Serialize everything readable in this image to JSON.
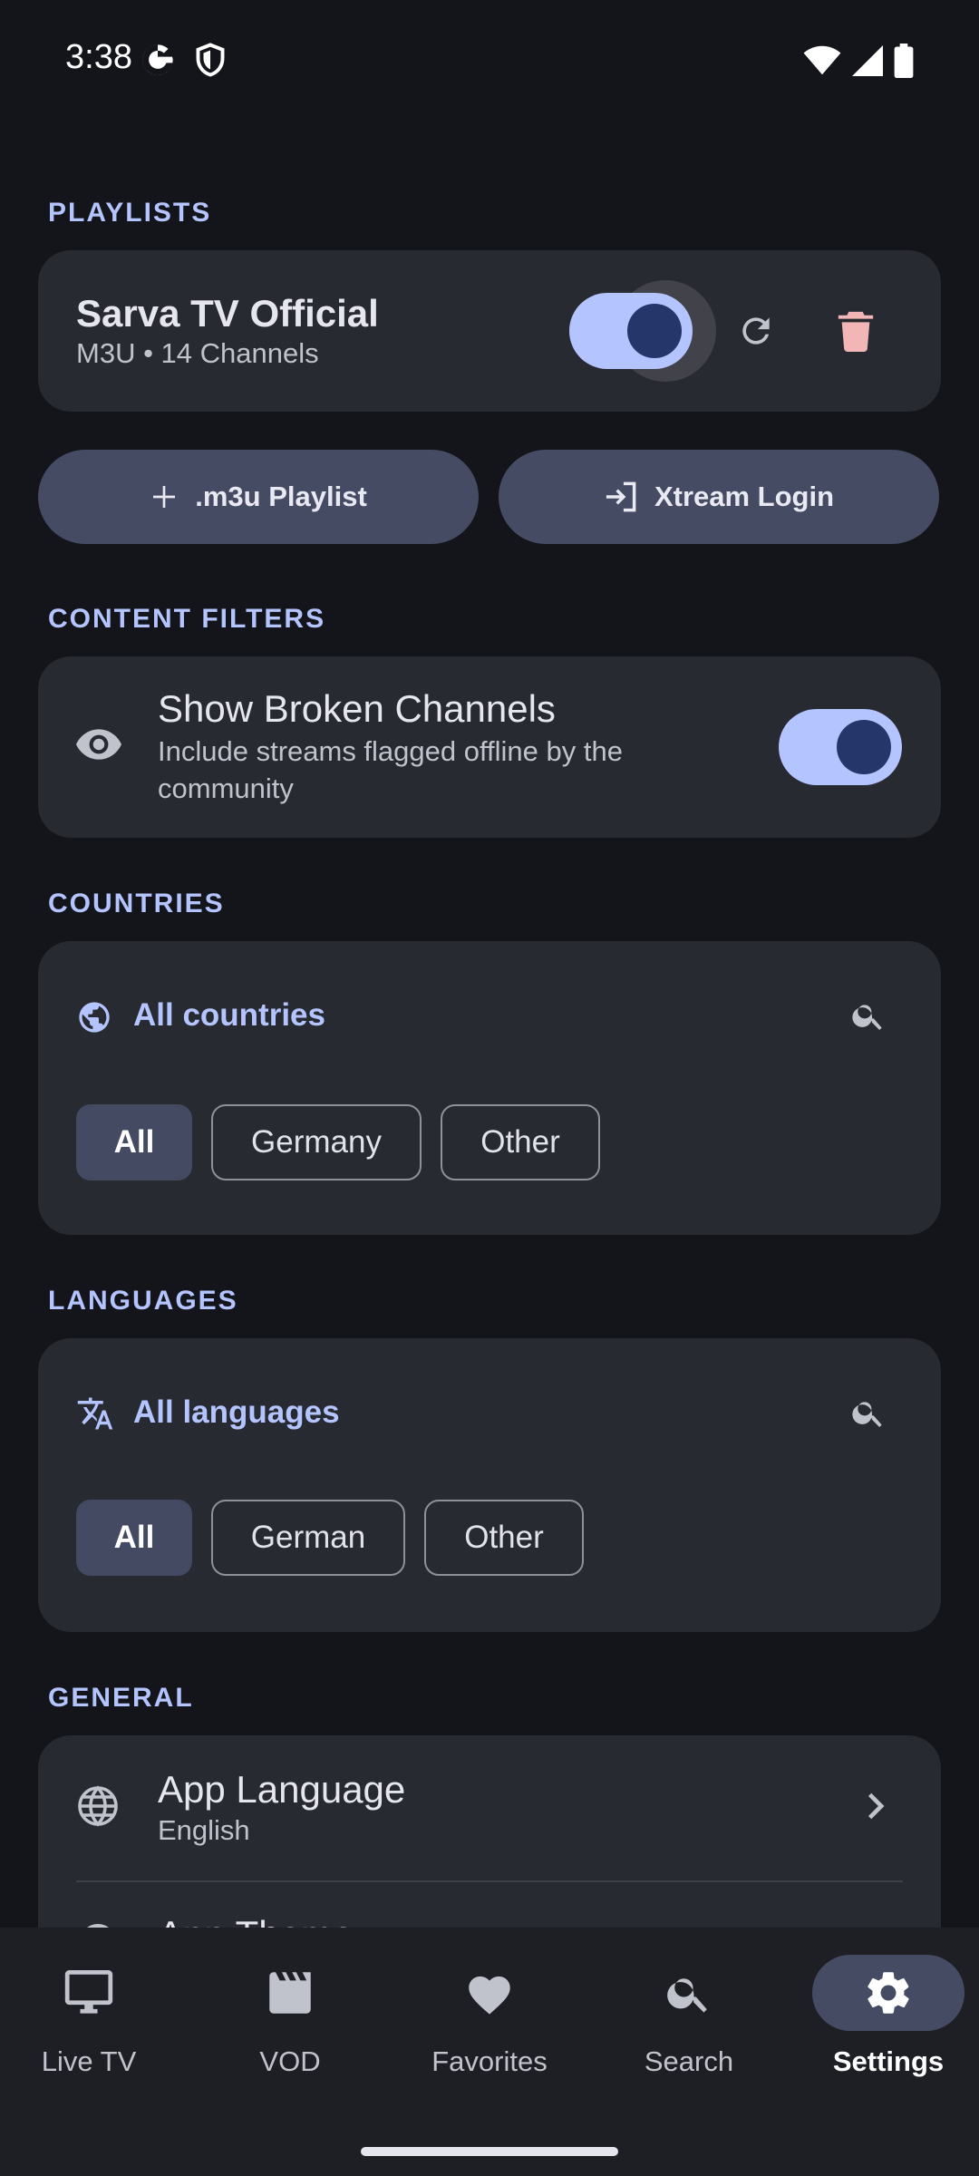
{
  "status_bar": {
    "time": "3:38"
  },
  "sections": {
    "playlists": "PLAYLISTS",
    "content_filters": "CONTENT FILTERS",
    "countries": "COUNTRIES",
    "languages": "LANGUAGES",
    "general": "GENERAL"
  },
  "playlist": {
    "name": "Sarva TV Official",
    "meta": "M3U • 14 Channels",
    "enabled": true
  },
  "buttons": {
    "add_m3u": ".m3u Playlist",
    "xtream_login": "Xtream Login"
  },
  "content_filter": {
    "title": "Show Broken Channels",
    "subtitle_line1": "Include streams flagged offline by the",
    "subtitle_line2": "community",
    "enabled": true
  },
  "countries": {
    "label": "All countries",
    "chips": [
      "All",
      "Germany",
      "Other"
    ],
    "selected": "All"
  },
  "languages": {
    "label": "All languages",
    "chips": [
      "All",
      "German",
      "Other"
    ],
    "selected": "All"
  },
  "general": {
    "app_language_title": "App Language",
    "app_language_value": "English",
    "next_item_partial": "App Theme"
  },
  "nav": {
    "items": [
      {
        "label": "Live TV",
        "icon": "tv-icon"
      },
      {
        "label": "VOD",
        "icon": "clapperboard-icon"
      },
      {
        "label": "Favorites",
        "icon": "heart-icon"
      },
      {
        "label": "Search",
        "icon": "search-icon"
      },
      {
        "label": "Settings",
        "icon": "gear-icon"
      }
    ],
    "active": "Settings"
  },
  "colors": {
    "accent": "#b4c4ff",
    "delete": "#f2b6b6",
    "background": "#14151a",
    "card": "#282a31"
  }
}
